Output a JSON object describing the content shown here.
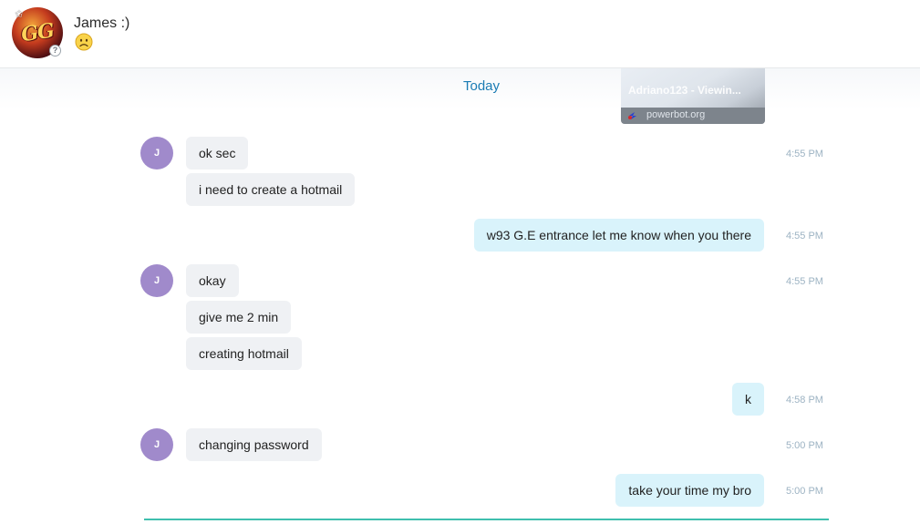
{
  "header": {
    "contact_name": "James :)",
    "avatar_text": "GG",
    "status_badge": "?",
    "mood_icon": "frowning-face-icon"
  },
  "conversation": {
    "date_separator": "Today",
    "link_preview": {
      "title": "Adriano123 - Viewin...",
      "domain": "powerbot.org"
    },
    "messages": [
      {
        "sender": "J",
        "direction": "in",
        "text": "ok sec",
        "time": "4:55 PM"
      },
      {
        "sender": "J",
        "direction": "in",
        "text": "i need to create a hotmail",
        "time": ""
      },
      {
        "sender": "me",
        "direction": "out",
        "text": "w93 G.E entrance let me know when you there",
        "time": "4:55 PM"
      },
      {
        "sender": "J",
        "direction": "in",
        "text": "okay",
        "time": "4:55 PM"
      },
      {
        "sender": "J",
        "direction": "in",
        "text": "give me 2 min",
        "time": ""
      },
      {
        "sender": "J",
        "direction": "in",
        "text": "creating hotmail",
        "time": ""
      },
      {
        "sender": "me",
        "direction": "out",
        "text": "k",
        "time": "4:58 PM"
      },
      {
        "sender": "J",
        "direction": "in",
        "text": "changing password",
        "time": "5:00 PM"
      },
      {
        "sender": "me",
        "direction": "out",
        "text": "take your time my bro",
        "time": "5:00 PM"
      }
    ]
  },
  "colors": {
    "incoming_bubble": "#eff1f4",
    "outgoing_bubble": "#d9f3fb",
    "avatar_purple": "#a08acb",
    "date_blue": "#1b7cb4",
    "time_gray": "#9db3c3"
  }
}
